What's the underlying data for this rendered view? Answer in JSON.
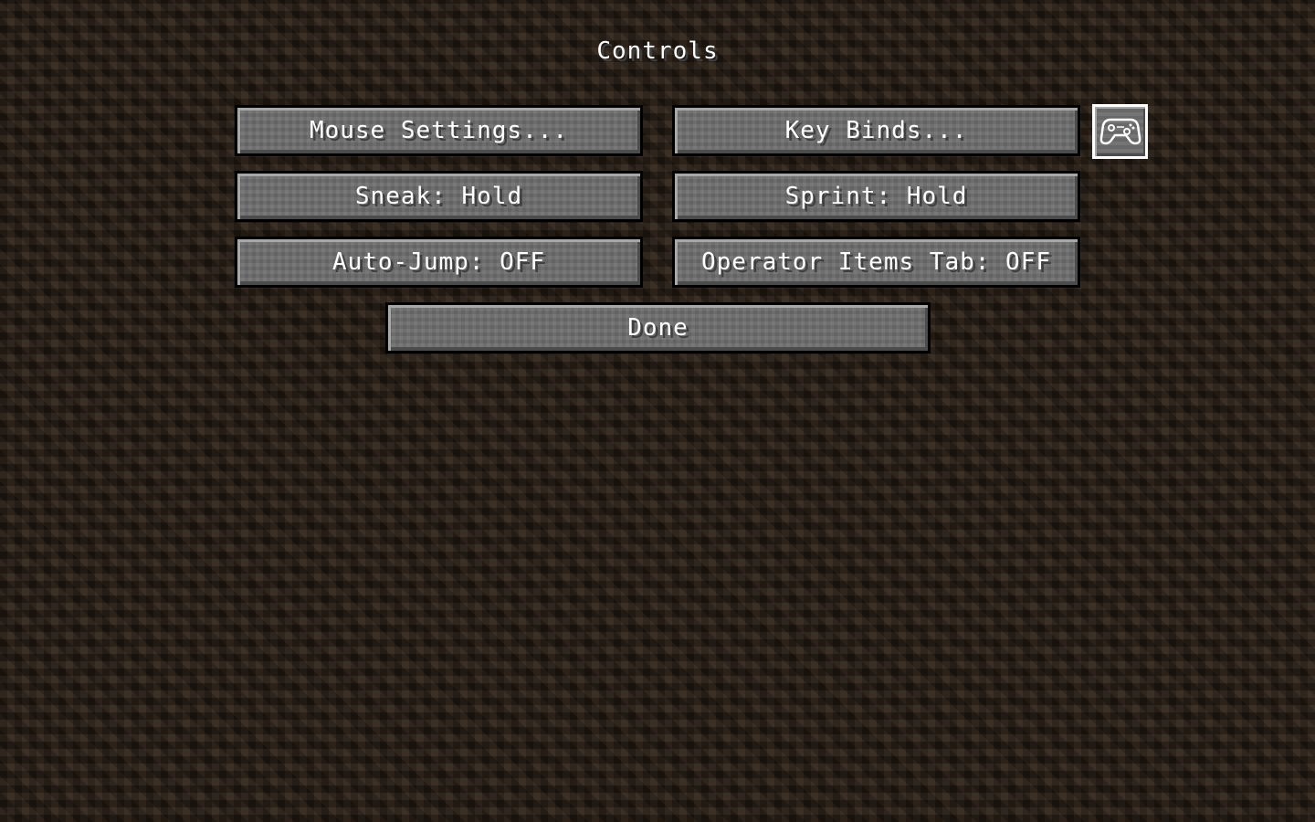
{
  "screen": {
    "title": "Controls"
  },
  "buttons": {
    "mouse_settings": "Mouse Settings...",
    "key_binds": "Key Binds...",
    "sneak": "Sneak: Hold",
    "sprint": "Sprint: Hold",
    "auto_jump": "Auto-Jump: OFF",
    "operator_items_tab": "Operator Items Tab: OFF",
    "done": "Done"
  },
  "icons": {
    "controller": "controller-icon"
  },
  "colors": {
    "background": "#2a2017",
    "button_face": "#6f6f6f",
    "text": "#ffffff",
    "controller_border": "#ffffff"
  }
}
